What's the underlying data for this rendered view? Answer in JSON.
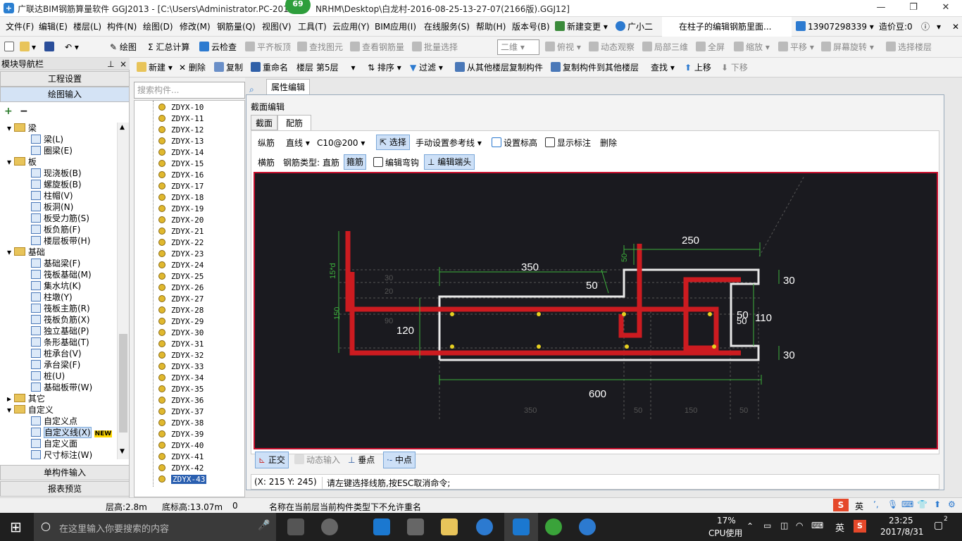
{
  "window": {
    "title": "广联达BIM钢筋算量软件 GGJ2013 - [C:\\Users\\Administrator.PC-201",
    "title_tail": "NRHM\\Desktop\\白龙村-2016-08-25-13-27-07(2166版).GGJ12]",
    "badge": "69"
  },
  "menu": [
    "文件(F)",
    "编辑(E)",
    "楼层(L)",
    "构件(N)",
    "绘图(D)",
    "修改(M)",
    "钢筋量(Q)",
    "视图(V)",
    "工具(T)",
    "云应用(Y)",
    "BIM应用(I)",
    "在线服务(S)",
    "帮助(H)",
    "版本号(B)",
    "新建变更",
    "广小二",
    "在柱子的编辑钢筋里面...",
    "13907298339",
    "造价豆:0"
  ],
  "toolbar1": [
    "绘图",
    "汇总计算",
    "云检查",
    "平齐板顶",
    "查找图元",
    "查看钢筋量",
    "批量选择",
    "二维",
    "俯视",
    "动态观察",
    "局部三维",
    "全屏",
    "缩放",
    "平移",
    "屏幕旋转",
    "选择楼层"
  ],
  "toolbar2": {
    "new": "新建",
    "delete": "删除",
    "copy": "复制",
    "rename": "重命名",
    "floor_label": "楼层",
    "floor_value": "第5层",
    "sort": "排序",
    "filter": "过滤",
    "copy_from_other": "从其他楼层复制构件",
    "copy_to_other": "复制构件到其他楼层",
    "find": "查找",
    "move_up": "上移",
    "move_down": "下移"
  },
  "nav": {
    "title": "模块导航栏",
    "pin": "ᵖ",
    "close": "×",
    "project_settings": "工程设置",
    "drawing_input": "绘图输入",
    "single_input": "单构件输入",
    "report_preview": "报表预览",
    "tree": [
      {
        "label": "梁",
        "level": 0,
        "folder": true
      },
      {
        "label": "梁(L)",
        "level": 1
      },
      {
        "label": "圈梁(E)",
        "level": 1
      },
      {
        "label": "板",
        "level": 0,
        "folder": true
      },
      {
        "label": "现浇板(B)",
        "level": 1
      },
      {
        "label": "螺旋板(B)",
        "level": 1
      },
      {
        "label": "柱帽(V)",
        "level": 1
      },
      {
        "label": "板洞(N)",
        "level": 1
      },
      {
        "label": "板受力筋(S)",
        "level": 1
      },
      {
        "label": "板负筋(F)",
        "level": 1
      },
      {
        "label": "楼层板带(H)",
        "level": 1
      },
      {
        "label": "基础",
        "level": 0,
        "folder": true
      },
      {
        "label": "基础梁(F)",
        "level": 1
      },
      {
        "label": "筏板基础(M)",
        "level": 1
      },
      {
        "label": "集水坑(K)",
        "level": 1
      },
      {
        "label": "柱墩(Y)",
        "level": 1
      },
      {
        "label": "筏板主筋(R)",
        "level": 1
      },
      {
        "label": "筏板负筋(X)",
        "level": 1
      },
      {
        "label": "独立基础(P)",
        "level": 1
      },
      {
        "label": "条形基础(T)",
        "level": 1
      },
      {
        "label": "桩承台(V)",
        "level": 1
      },
      {
        "label": "承台梁(F)",
        "level": 1
      },
      {
        "label": "桩(U)",
        "level": 1
      },
      {
        "label": "基础板带(W)",
        "level": 1
      },
      {
        "label": "其它",
        "level": 0,
        "folder": true,
        "collapsed": true
      },
      {
        "label": "自定义",
        "level": 0,
        "folder": true
      },
      {
        "label": "自定义点",
        "level": 1
      },
      {
        "label": "自定义线(X)",
        "level": 1,
        "selected": true
      },
      {
        "label": "自定义面",
        "level": 1
      },
      {
        "label": "尺寸标注(W)",
        "level": 1
      }
    ],
    "new_badge": "NEW"
  },
  "search": {
    "placeholder": "搜索构件..."
  },
  "components": [
    "ZDYX-10",
    "ZDYX-11",
    "ZDYX-12",
    "ZDYX-13",
    "ZDYX-14",
    "ZDYX-15",
    "ZDYX-16",
    "ZDYX-17",
    "ZDYX-18",
    "ZDYX-19",
    "ZDYX-20",
    "ZDYX-21",
    "ZDYX-22",
    "ZDYX-23",
    "ZDYX-24",
    "ZDYX-25",
    "ZDYX-26",
    "ZDYX-27",
    "ZDYX-28",
    "ZDYX-29",
    "ZDYX-30",
    "ZDYX-31",
    "ZDYX-32",
    "ZDYX-33",
    "ZDYX-34",
    "ZDYX-35",
    "ZDYX-36",
    "ZDYX-37",
    "ZDYX-38",
    "ZDYX-39",
    "ZDYX-40",
    "ZDYX-41",
    "ZDYX-42",
    "ZDYX-43"
  ],
  "selected_component": "ZDYX-43",
  "props_tab": "属性编辑",
  "section_editor": {
    "title": "截面编辑",
    "tabs": [
      "截面",
      "配筋"
    ],
    "active_tab": "配筋",
    "row1": {
      "long_bar": "纵筋",
      "line": "直线",
      "spec": "C10@200",
      "select": "选择",
      "manual_ref": "手动设置参考线",
      "set_elev": "设置标高",
      "show_dim": "显示标注",
      "delete": "删除"
    },
    "row2": {
      "trans_bar": "横筋",
      "bar_type_label": "钢筋类型:",
      "straight": "直筋",
      "stirrup": "箍筋",
      "edit_hook": "编辑弯钩",
      "edit_end": "编辑端头"
    },
    "bottom": {
      "ortho": "正交",
      "dynamic_input": "动态输入",
      "perp": "垂点",
      "mid": "中点"
    },
    "coords": "(X: 215 Y: 245)",
    "prompt": "请左键选择线筋,按ESC取消命令;"
  },
  "drawing": {
    "dims": {
      "d250": "250",
      "d350": "350",
      "d50a": "50",
      "d50b": "50",
      "d30a": "30",
      "d30b": "30",
      "d110": "110",
      "d50c": "50",
      "d50d": "50",
      "d120": "120",
      "d600": "600",
      "d15d": "15*d",
      "d150": "150",
      "d30c": "30",
      "d20": "20",
      "d90": "90",
      "b350": "350",
      "b50a": "50",
      "b150": "150",
      "b50b": "50"
    }
  },
  "status": {
    "floor_height": "层高:2.8m",
    "bottom_elev": "底标高:13.07m",
    "zero": "0",
    "message": "名称在当前层当前构件类型下不允许重名"
  },
  "taskbar": {
    "search_placeholder": "在这里输入你要搜索的内容",
    "cpu_percent": "17%",
    "cpu_label": "CPU使用",
    "time": "23:25",
    "date": "2017/8/31",
    "ime": "英",
    "ime2": "英",
    "notif": "2"
  }
}
